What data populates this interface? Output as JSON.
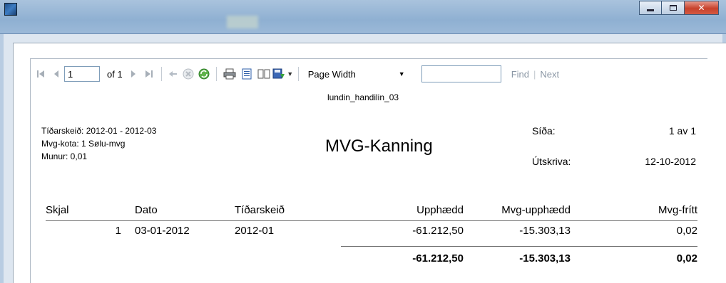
{
  "toolbar": {
    "page_value": "1",
    "page_of": "of 1",
    "zoom": "Page Width",
    "find": "Find",
    "divider": "|",
    "next": "Next"
  },
  "report": {
    "name": "lundin_handilin_03",
    "title": "MVG-Kanning",
    "info": {
      "period": "Tíðarskeið: 2012-01 - 2012-03",
      "vat_code": "Mvg-kota: 1 Sølu-mvg",
      "difference": "Munur: 0,01"
    },
    "meta": {
      "page_label": "Síða:",
      "page_value": "1 av 1",
      "printed_label": "Útskriva:",
      "printed_value": "12-10-2012"
    },
    "columns": [
      "Skjal",
      "Dato",
      "Tíðarskeið",
      "Upphædd",
      "Mvg-upphædd",
      "Mvg-frítt"
    ],
    "rows": [
      {
        "skjal": "1",
        "dato": "03-01-2012",
        "period": "2012-01",
        "amount": "-61.212,50",
        "vat": "-15.303,13",
        "free": "0,02"
      }
    ],
    "totals": {
      "amount": "-61.212,50",
      "vat": "-15.303,13",
      "free": "0,02"
    }
  },
  "icons": [
    "first-page-icon",
    "prev-page-icon",
    "next-page-icon",
    "last-page-icon",
    "back-icon",
    "stop-icon",
    "refresh-icon",
    "print-icon",
    "print-layout-icon",
    "page-setup-icon",
    "export-icon",
    "dropdown-arrow-icon"
  ]
}
